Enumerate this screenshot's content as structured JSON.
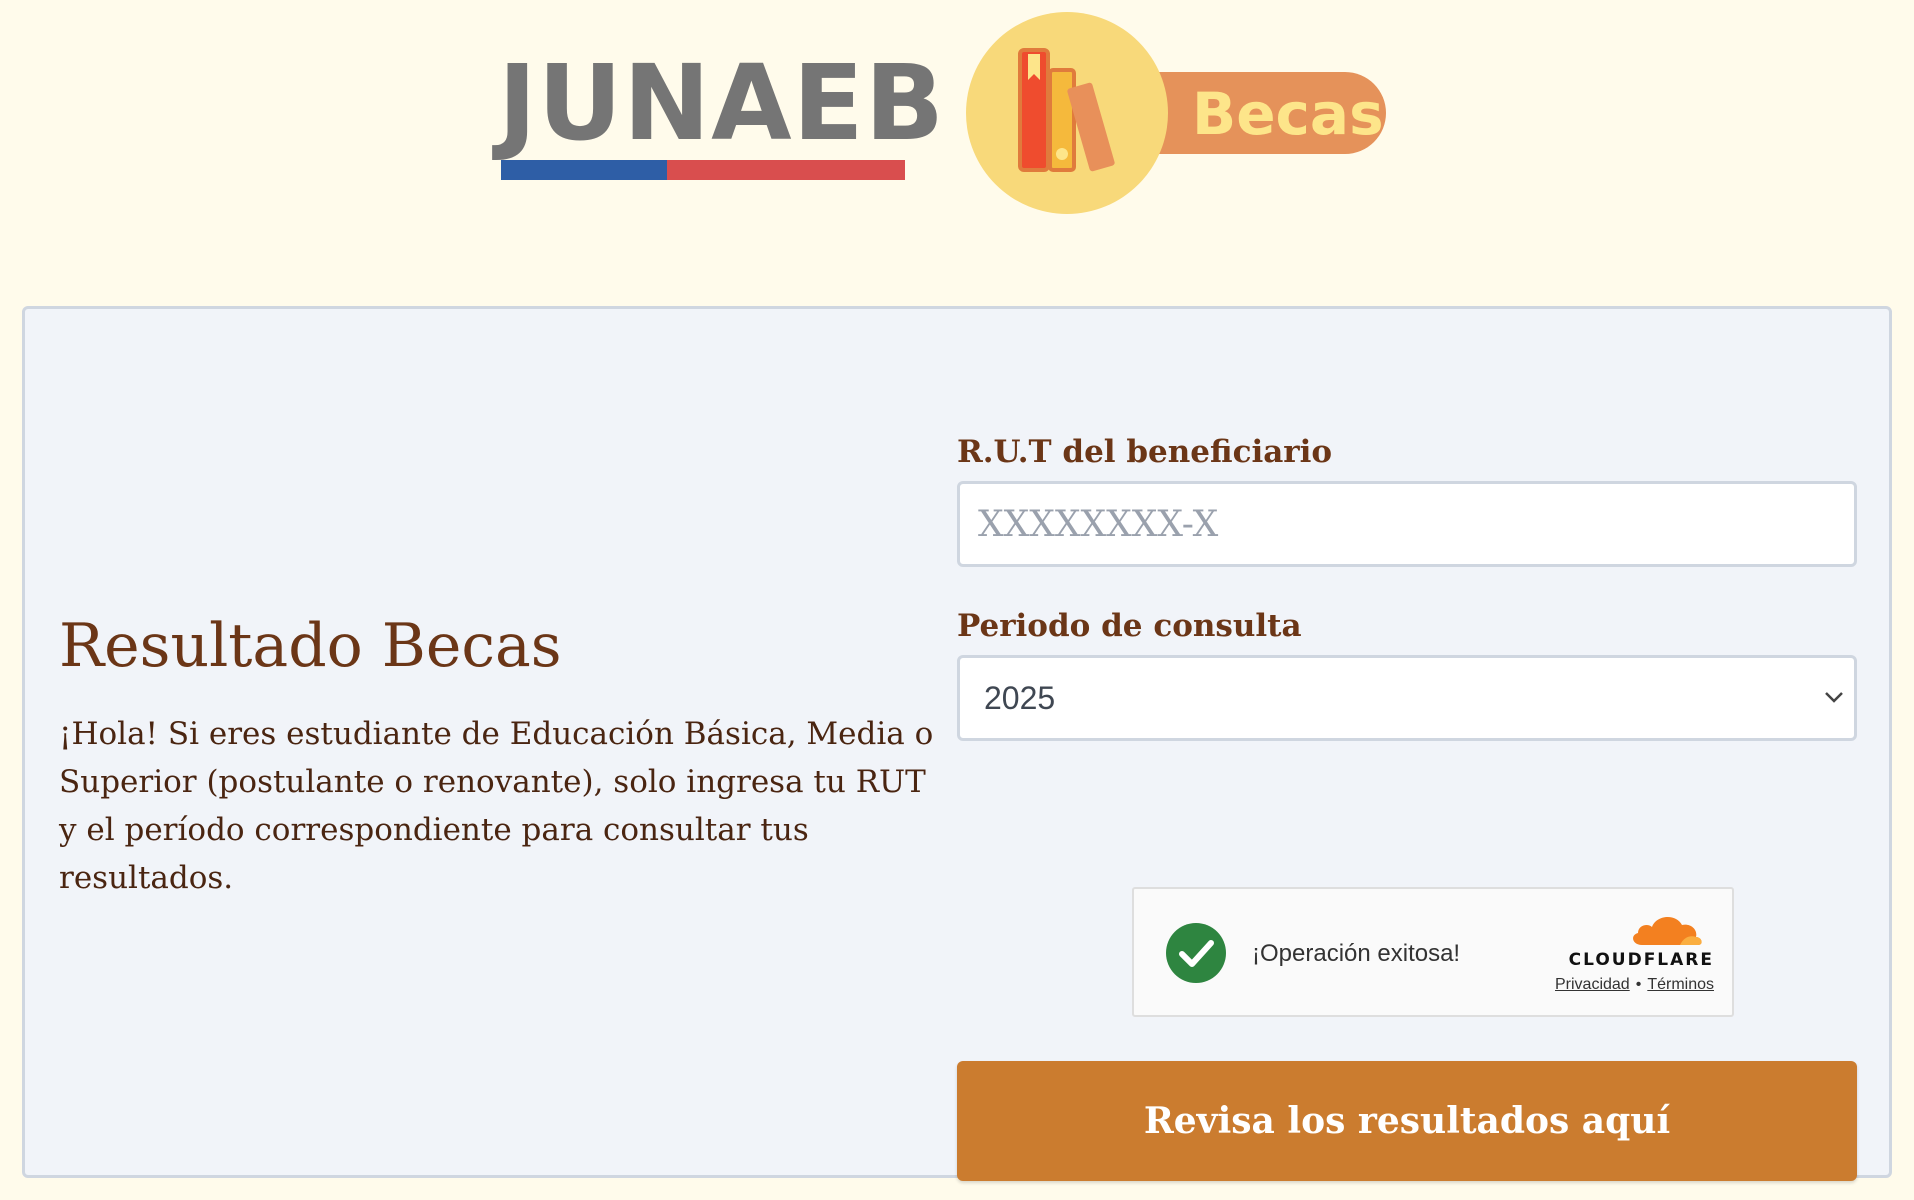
{
  "header": {
    "junaeb_logo_text": "JUNAEB",
    "becas_logo_text": "Becas"
  },
  "intro": {
    "title": "Resultado Becas",
    "description": "¡Hola! Si eres estudiante de Educación Básica, Media o Superior (postulante o renovante), solo ingresa tu RUT y el período correspondiente para consultar tus resultados."
  },
  "form": {
    "rut_label": "R.U.T del beneficiario",
    "rut_value": "",
    "rut_placeholder": "XXXXXXXX-X",
    "periodo_label": "Periodo de consulta",
    "periodo_selected": "2025",
    "submit_label": "Revisa los resultados aquí"
  },
  "captcha": {
    "status_text": "¡Operación exitosa!",
    "brand": "CLOUDFLARE",
    "privacy_link": "Privacidad",
    "separator": "•",
    "terms_link": "Términos",
    "icon": "check-circle-icon"
  },
  "colors": {
    "page_bg": "#fffbeb",
    "card_bg": "#f1f4f9",
    "heading_brown": "#6b3617",
    "button_orange": "#cb7c2f",
    "success_green": "#2e8540",
    "flag_blue": "#2e5ea6",
    "flag_red": "#d94e4e"
  }
}
